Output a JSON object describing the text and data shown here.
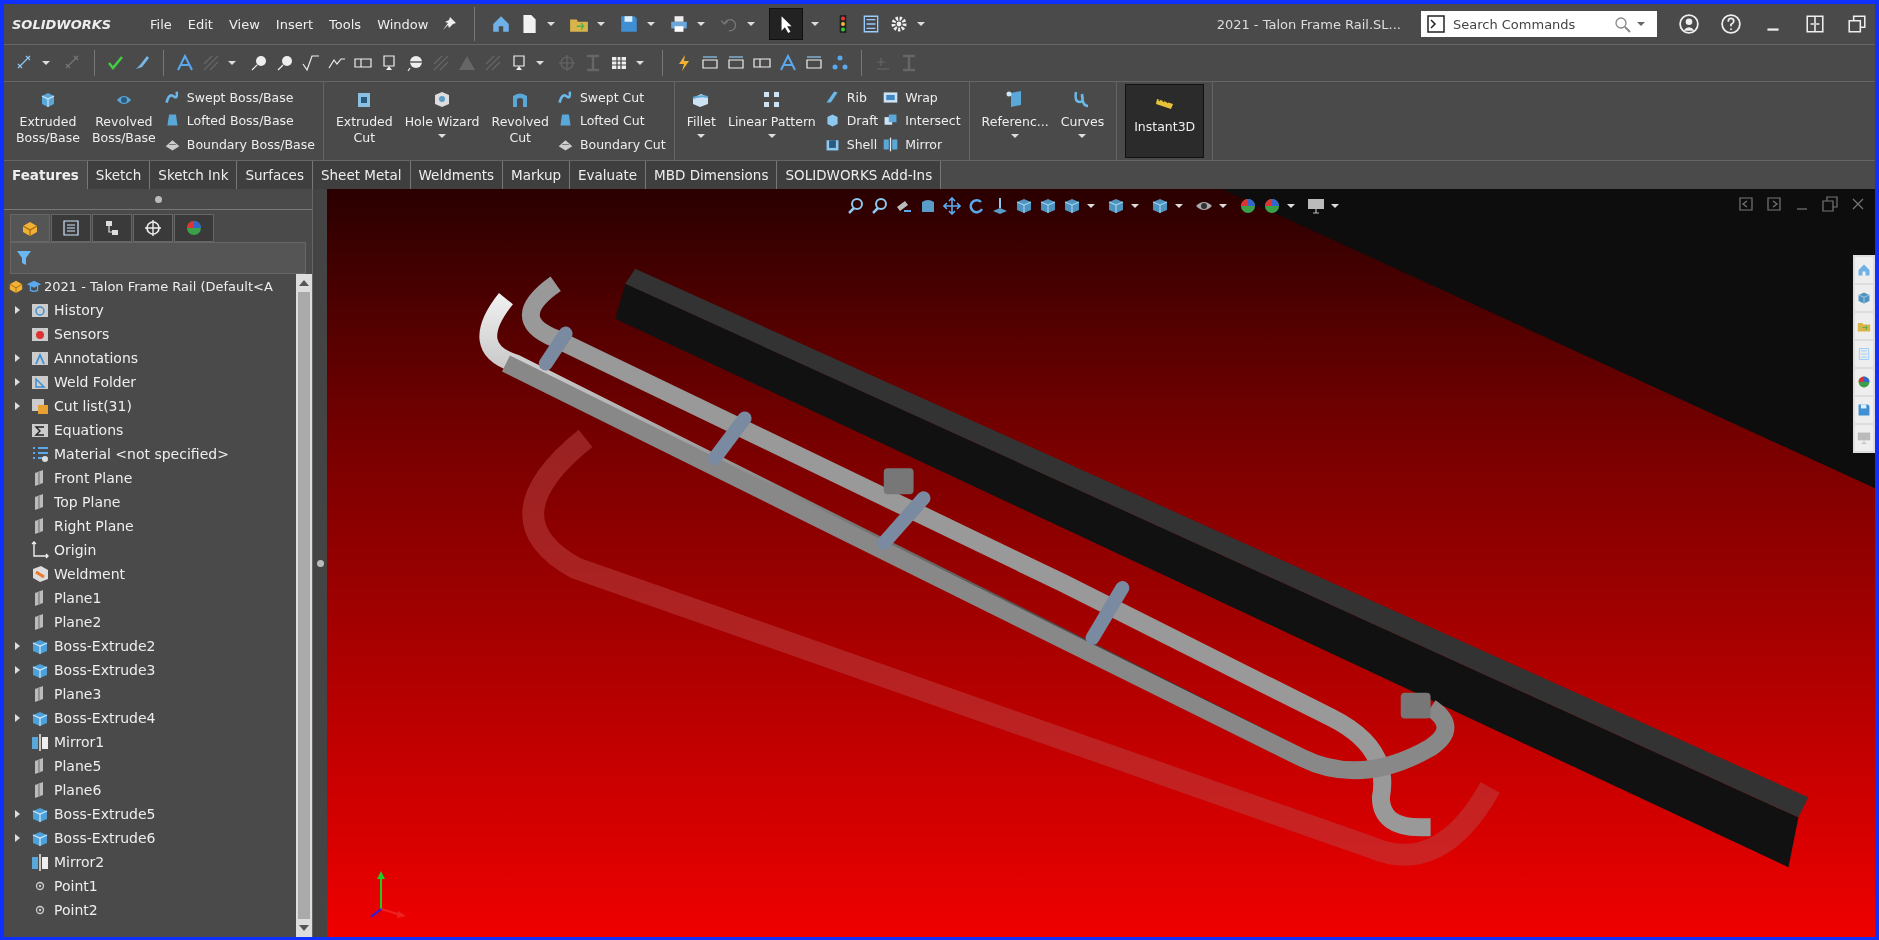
{
  "app": {
    "logo": "SOLIDWORKS",
    "title": "2021 - Talon Frame Rail.SL..."
  },
  "menu": [
    "File",
    "Edit",
    "View",
    "Insert",
    "Tools",
    "Window"
  ],
  "search": {
    "placeholder": "Search Commands"
  },
  "ribbon": {
    "groups": [
      {
        "items": [
          {
            "kind": "large",
            "label": "Extruded\nBoss/Base",
            "dropdown": false,
            "pressed": false
          },
          {
            "kind": "large",
            "label": "Revolved\nBoss/Base",
            "dropdown": false,
            "pressed": false
          },
          {
            "kind": "column",
            "entries": [
              {
                "label": "Swept Boss/Base"
              },
              {
                "label": "Lofted Boss/Base"
              },
              {
                "label": "Boundary Boss/Base"
              }
            ]
          }
        ]
      },
      {
        "items": [
          {
            "kind": "large",
            "label": "Extruded\nCut",
            "dropdown": false,
            "pressed": false
          },
          {
            "kind": "large",
            "label": "Hole Wizard",
            "dropdown": true,
            "pressed": false
          },
          {
            "kind": "large",
            "label": "Revolved\nCut",
            "dropdown": false,
            "pressed": false
          },
          {
            "kind": "column",
            "entries": [
              {
                "label": "Swept Cut"
              },
              {
                "label": "Lofted Cut"
              },
              {
                "label": "Boundary Cut"
              }
            ]
          }
        ]
      },
      {
        "items": [
          {
            "kind": "large",
            "label": "Fillet",
            "dropdown": true,
            "pressed": false
          },
          {
            "kind": "large",
            "label": "Linear Pattern",
            "dropdown": true,
            "pressed": false
          },
          {
            "kind": "column",
            "entries": [
              {
                "label": "Rib"
              },
              {
                "label": "Draft"
              },
              {
                "label": "Shell"
              }
            ]
          },
          {
            "kind": "column",
            "entries": [
              {
                "label": "Wrap"
              },
              {
                "label": "Intersect"
              },
              {
                "label": "Mirror"
              }
            ]
          }
        ]
      },
      {
        "items": [
          {
            "kind": "large",
            "label": "Referenc...",
            "dropdown": true,
            "pressed": false
          },
          {
            "kind": "large",
            "label": "Curves",
            "dropdown": true,
            "pressed": false
          }
        ]
      },
      {
        "items": [
          {
            "kind": "large",
            "label": "Instant3D",
            "dropdown": false,
            "pressed": true
          }
        ]
      }
    ]
  },
  "panel_tabs": [
    {
      "selected": true
    },
    {
      "selected": false
    },
    {
      "selected": false
    },
    {
      "selected": false
    },
    {
      "selected": false
    }
  ],
  "tabs": [
    {
      "label": "Features",
      "selected": true
    },
    {
      "label": "Sketch",
      "selected": false
    },
    {
      "label": "Sketch Ink",
      "selected": false
    },
    {
      "label": "Surfaces",
      "selected": false
    },
    {
      "label": "Sheet Metal",
      "selected": false
    },
    {
      "label": "Weldments",
      "selected": false
    },
    {
      "label": "Markup",
      "selected": false
    },
    {
      "label": "Evaluate",
      "selected": false
    },
    {
      "label": "MBD Dimensions",
      "selected": false
    },
    {
      "label": "SOLIDWORKS Add-Ins",
      "selected": false
    }
  ],
  "tree": {
    "root": "2021 - Talon Frame Rail  (Default<A",
    "items": [
      {
        "label": "History",
        "kind": "history",
        "expandable": true
      },
      {
        "label": "Sensors",
        "kind": "sensors",
        "expandable": false
      },
      {
        "label": "Annotations",
        "kind": "annotations",
        "expandable": true
      },
      {
        "label": "Weld Folder",
        "kind": "weld",
        "expandable": true
      },
      {
        "label": "Cut list(31)",
        "kind": "cutlist",
        "expandable": true
      },
      {
        "label": "Equations",
        "kind": "equations",
        "expandable": false
      },
      {
        "label": "Material <not specified>",
        "kind": "material",
        "expandable": false
      },
      {
        "label": "Front Plane",
        "kind": "plane",
        "expandable": false
      },
      {
        "label": "Top Plane",
        "kind": "plane",
        "expandable": false
      },
      {
        "label": "Right Plane",
        "kind": "plane",
        "expandable": false
      },
      {
        "label": "Origin",
        "kind": "origin",
        "expandable": false
      },
      {
        "label": "Weldment",
        "kind": "weldment",
        "expandable": false
      },
      {
        "label": "Plane1",
        "kind": "plane",
        "expandable": false
      },
      {
        "label": "Plane2",
        "kind": "plane",
        "expandable": false
      },
      {
        "label": "Boss-Extrude2",
        "kind": "extrude",
        "expandable": true
      },
      {
        "label": "Boss-Extrude3",
        "kind": "extrude",
        "expandable": true
      },
      {
        "label": "Plane3",
        "kind": "plane",
        "expandable": false
      },
      {
        "label": "Boss-Extrude4",
        "kind": "extrude",
        "expandable": true
      },
      {
        "label": "Mirror1",
        "kind": "mirror",
        "expandable": false
      },
      {
        "label": "Plane5",
        "kind": "plane",
        "expandable": false
      },
      {
        "label": "Plane6",
        "kind": "plane",
        "expandable": false
      },
      {
        "label": "Boss-Extrude5",
        "kind": "extrude",
        "expandable": true
      },
      {
        "label": "Boss-Extrude6",
        "kind": "extrude",
        "expandable": true
      },
      {
        "label": "Mirror2",
        "kind": "mirror",
        "expandable": false
      },
      {
        "label": "Point1",
        "kind": "point",
        "expandable": false
      },
      {
        "label": "Point2",
        "kind": "point",
        "expandable": false
      }
    ]
  }
}
